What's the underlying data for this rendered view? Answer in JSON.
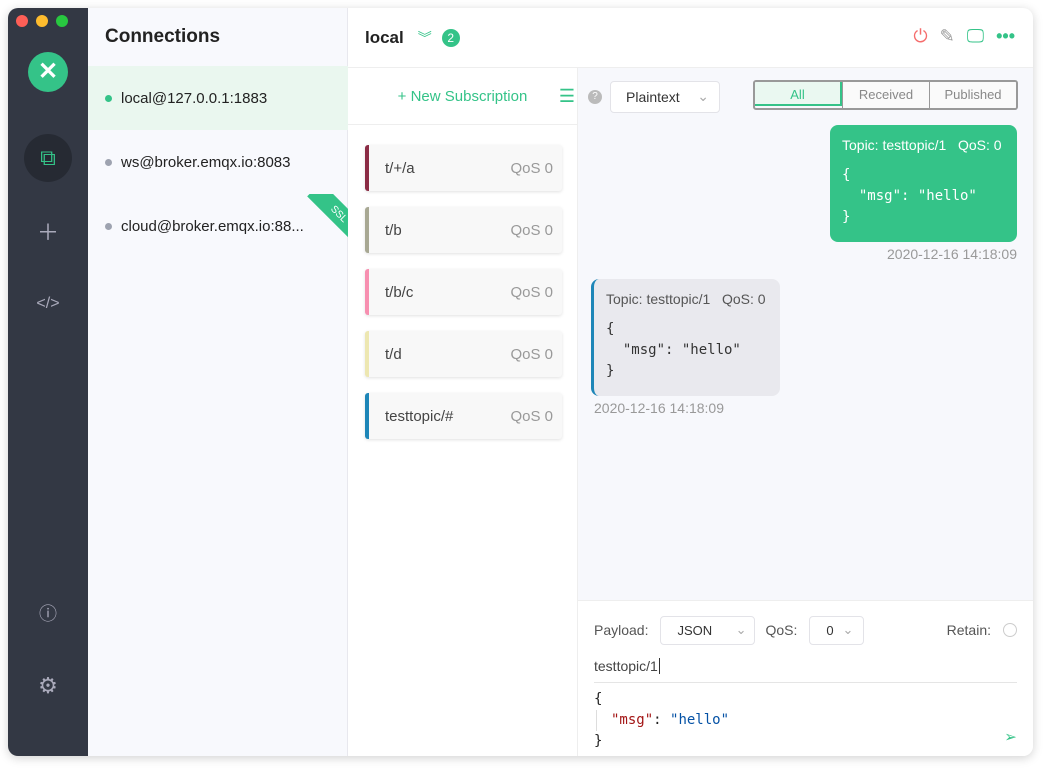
{
  "sidebar": {
    "items": [
      "connections-icon",
      "plus-icon",
      "code-icon",
      "info-icon",
      "gear-icon"
    ]
  },
  "connections": {
    "title": "Connections",
    "items": [
      {
        "name": "local@127.0.0.1:1883",
        "status": "connected",
        "ssl": false
      },
      {
        "name": "ws@broker.emqx.io:8083",
        "status": "disconnected",
        "ssl": false
      },
      {
        "name": "cloud@broker.emqx.io:88...",
        "status": "disconnected",
        "ssl": true,
        "ssl_label": "SSL"
      }
    ]
  },
  "header": {
    "title": "local",
    "badge": "2"
  },
  "subscriptions": {
    "new_label": "+ New Subscription",
    "items": [
      {
        "topic": "t/+/a",
        "qos": "QoS 0",
        "color": "#8b2c45"
      },
      {
        "topic": "t/b",
        "qos": "QoS 0",
        "color": "#a8a893"
      },
      {
        "topic": "t/b/c",
        "qos": "QoS 0",
        "color": "#f78fb0"
      },
      {
        "topic": "t/d",
        "qos": "QoS 0",
        "color": "#ede7b1"
      },
      {
        "topic": "testtopic/#",
        "qos": "QoS 0",
        "color": "#1e86b8"
      }
    ]
  },
  "messages": {
    "format": "Plaintext",
    "filters": [
      "All",
      "Received",
      "Published"
    ],
    "active_filter": "All",
    "items": [
      {
        "direction": "published",
        "topic": "Topic: testtopic/1",
        "qos": "QoS: 0",
        "payload": "{\n  \"msg\": \"hello\"\n}",
        "time": "2020-12-16 14:18:09"
      },
      {
        "direction": "received",
        "topic": "Topic: testtopic/1",
        "qos": "QoS: 0",
        "payload": "{\n  \"msg\": \"hello\"\n}",
        "time": "2020-12-16 14:18:09"
      }
    ]
  },
  "publish": {
    "payload_label": "Payload:",
    "payload_type": "JSON",
    "qos_label": "QoS:",
    "qos": "0",
    "retain_label": "Retain:",
    "topic": "testtopic/1",
    "key": "\"msg\"",
    "value": "\"hello\""
  },
  "colors": {
    "accent": "#34c388",
    "sidebar": "#333844"
  }
}
